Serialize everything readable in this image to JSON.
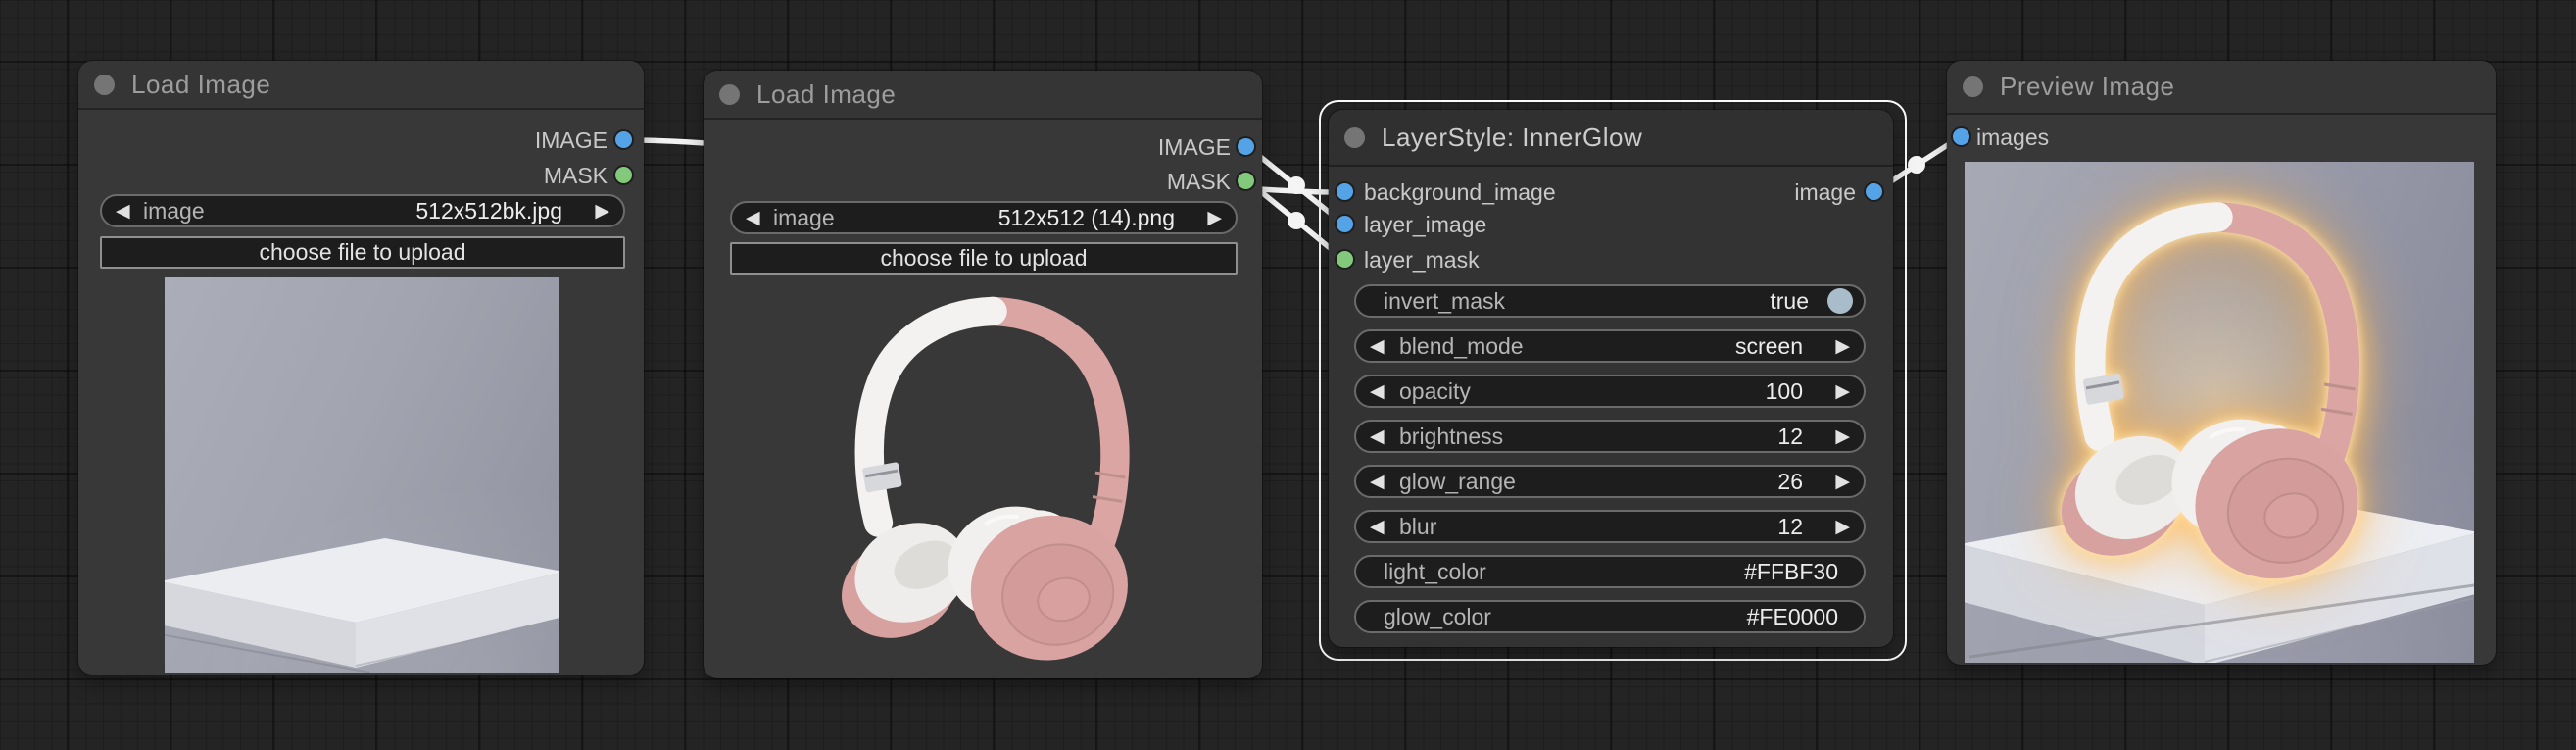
{
  "icons": {
    "prev": "◀",
    "next": "▶"
  },
  "colors": {
    "link": "#f2f2f2",
    "slot_image": "#55a3e7",
    "slot_mask": "#82c97b",
    "title_dot": "#757575",
    "toggle_true": "#a9bcc9",
    "selection_outline": "#fafafa",
    "node_bg": "#383838",
    "canvas_bg": "#242424"
  },
  "node1": {
    "title": "Load Image",
    "outputs": [
      {
        "label": "IMAGE"
      },
      {
        "label": "MASK"
      }
    ],
    "combo": {
      "label": "image",
      "value": "512x512bk.jpg"
    },
    "upload_label": "choose file to upload",
    "preview": "gray studio podium"
  },
  "node2": {
    "title": "Load Image",
    "outputs": [
      {
        "label": "IMAGE"
      },
      {
        "label": "MASK"
      }
    ],
    "combo": {
      "label": "image",
      "value": "512x512 (14).png"
    },
    "upload_label": "choose file to upload",
    "preview": "rose gold and white headphones"
  },
  "node3": {
    "title": "LayerStyle: InnerGlow",
    "inputs": [
      {
        "label": "background_image"
      },
      {
        "label": "layer_image"
      },
      {
        "label": "layer_mask"
      }
    ],
    "output": {
      "label": "image"
    },
    "widgets": [
      {
        "label": "invert_mask",
        "value": "true",
        "type": "toggle"
      },
      {
        "label": "blend_mode",
        "value": "screen",
        "type": "combo"
      },
      {
        "label": "opacity",
        "value": "100",
        "type": "number"
      },
      {
        "label": "brightness",
        "value": "12",
        "type": "number"
      },
      {
        "label": "glow_range",
        "value": "26",
        "type": "number"
      },
      {
        "label": "blur",
        "value": "12",
        "type": "number"
      },
      {
        "label": "light_color",
        "value": "#FFBF30",
        "type": "text"
      },
      {
        "label": "glow_color",
        "value": "#FE0000",
        "type": "text"
      }
    ]
  },
  "node4": {
    "title": "Preview Image",
    "inputs": [
      {
        "label": "images"
      }
    ],
    "preview": "headphones with warm inner glow on podium"
  }
}
